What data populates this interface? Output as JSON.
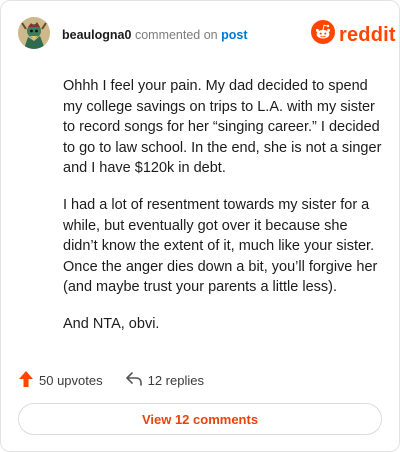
{
  "comment": {
    "author": "beaulogna0",
    "action_text": "commented on",
    "target_link": "post",
    "paragraphs": [
      "Ohhh I feel your pain. My dad decided to spend my college savings on trips to L.A. with my sister to record songs for her “singing career.” I decided to go to law school. In the end, she is not a singer and I have $120k in debt.",
      "I had a lot of resentment towards my sister for a while, but eventually got over it because she didn’t know the extent of it, much like your sister. Once the anger dies down a bit, you’ll forgive her (and maybe trust your parents a little less).",
      "And NTA, obvi."
    ]
  },
  "brand": {
    "name": "reddit",
    "color": "#ff4500"
  },
  "actions": {
    "upvotes_label": "50 upvotes",
    "replies_label": "12 replies",
    "view_comments_label": "View 12 comments"
  },
  "icons": {
    "upvote": "upvote-arrow-icon",
    "reply": "reply-arrow-icon",
    "brand": "reddit-snoo-icon",
    "avatar": "user-avatar"
  },
  "colors": {
    "accent": "#ff4500",
    "link": "#0079d3",
    "text": "#1c1c1c",
    "muted": "#7c7c7c"
  }
}
